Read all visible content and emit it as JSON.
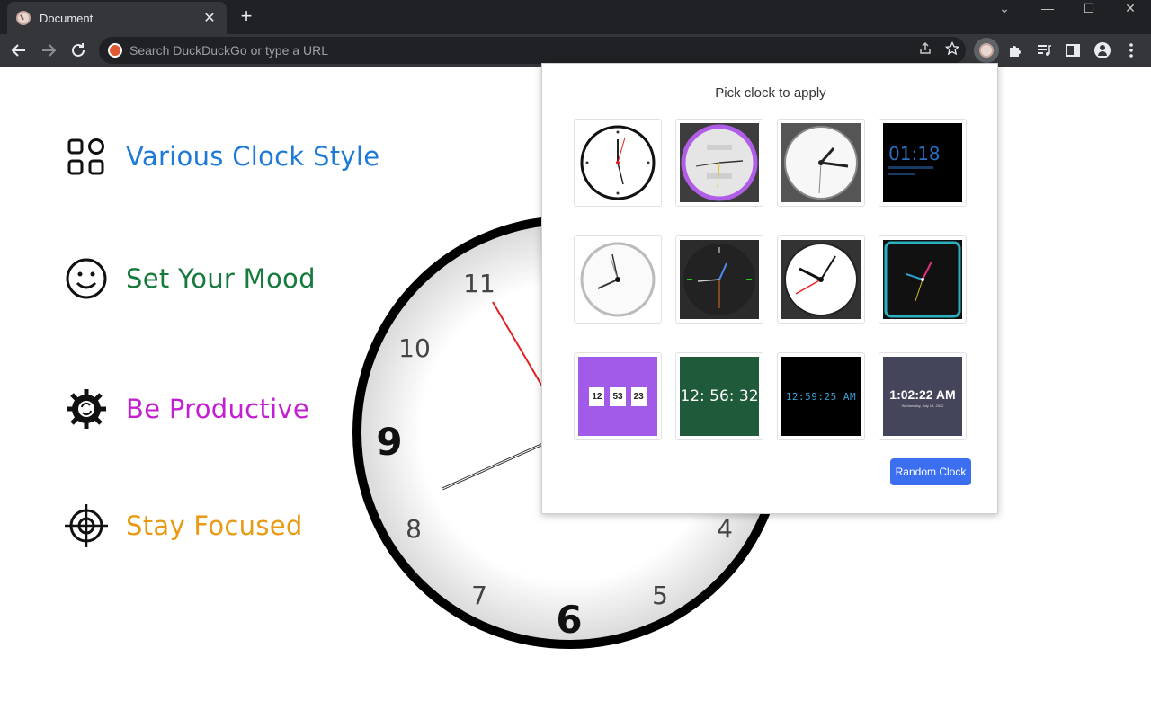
{
  "browser": {
    "tab_title": "Document",
    "tab_close_glyph": "✕",
    "new_tab_glyph": "+",
    "omnibox_placeholder": "Search DuckDuckGo or type a URL",
    "window_controls": [
      "⌄",
      "—",
      "☐",
      "✕"
    ],
    "icons": [
      "back-icon",
      "forward-icon",
      "reload-icon",
      "share-icon",
      "star-icon",
      "clock-extension-icon",
      "puzzle-icon",
      "media-icon",
      "sidepanel-icon",
      "profile-icon",
      "more-icon"
    ]
  },
  "features": [
    {
      "label": "Various Clock Style",
      "color": "#1e7ad8",
      "icon": "grid-icon"
    },
    {
      "label": "Set Your Mood",
      "color": "#167a3c",
      "icon": "smiley-icon"
    },
    {
      "label": "Be Productive",
      "color": "#c21fd0",
      "icon": "gear-icon"
    },
    {
      "label": "Stay Focused",
      "color": "#e89a12",
      "icon": "crosshair-icon"
    }
  ],
  "big_clock": {
    "numbers": [
      "11",
      "10",
      "9",
      "8",
      "7",
      "6",
      "5",
      "4"
    ]
  },
  "popup": {
    "title": "Pick clock to apply",
    "random_button": "Random Clock",
    "digital": {
      "c4_time": "01:18",
      "c9": [
        "12",
        "53",
        "23"
      ],
      "c10_time": "12: 56: 32",
      "c11_time": "12:59:25 AM",
      "c12_time": "1:02:22 AM",
      "c12_date": "Wednesday, July 13, 2022"
    }
  },
  "colors": {
    "accent_button": "#3b6ff0",
    "chrome_dark": "#202124",
    "chrome_mid": "#35363a"
  }
}
